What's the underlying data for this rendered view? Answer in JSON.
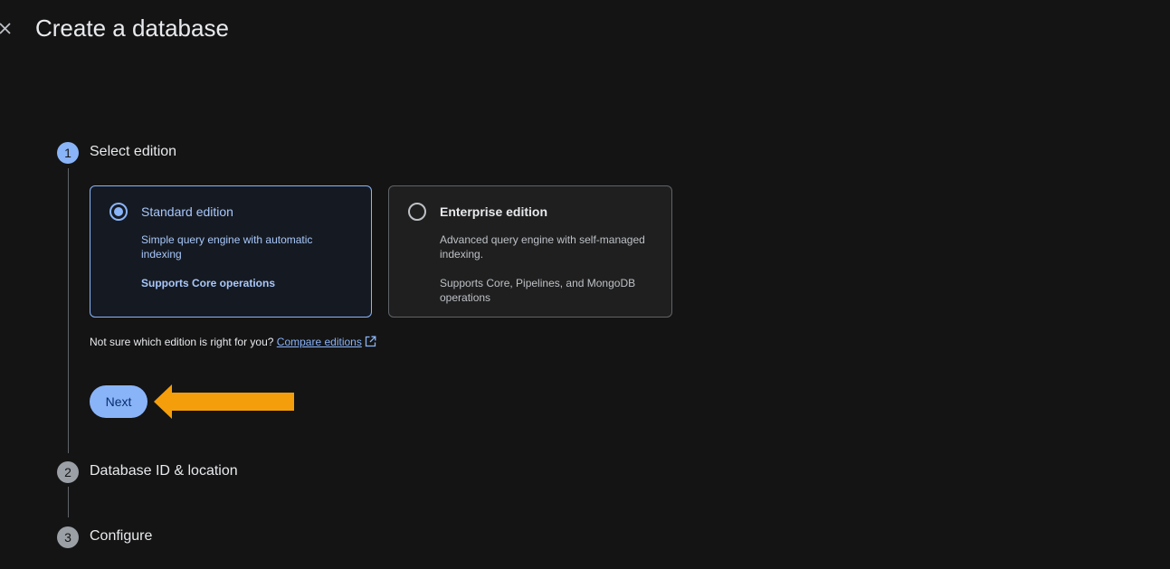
{
  "header": {
    "title": "Create a database",
    "close_icon": "close-icon"
  },
  "steps": [
    {
      "number": "1",
      "label": "Select edition",
      "state": "active"
    },
    {
      "number": "2",
      "label": "Database ID & location",
      "state": "inactive"
    },
    {
      "number": "3",
      "label": "Configure",
      "state": "inactive"
    }
  ],
  "editions": [
    {
      "title": "Standard edition",
      "description": "Simple query engine with automatic indexing",
      "operations": "Supports Core operations",
      "selected": true
    },
    {
      "title": "Enterprise edition",
      "description": "Advanced query engine with self-managed indexing.",
      "operations": "Supports Core, Pipelines, and MongoDB operations",
      "selected": false
    }
  ],
  "help": {
    "text": "Not sure which edition is right for you?",
    "link_label": "Compare editions",
    "link_icon": "open-in-new-icon"
  },
  "actions": {
    "next_label": "Next"
  },
  "annotation": {
    "arrow_icon": "arrow-left-icon",
    "arrow_color": "#f59e0b"
  },
  "colors": {
    "accent": "#8ab4f8",
    "background": "#141414"
  }
}
